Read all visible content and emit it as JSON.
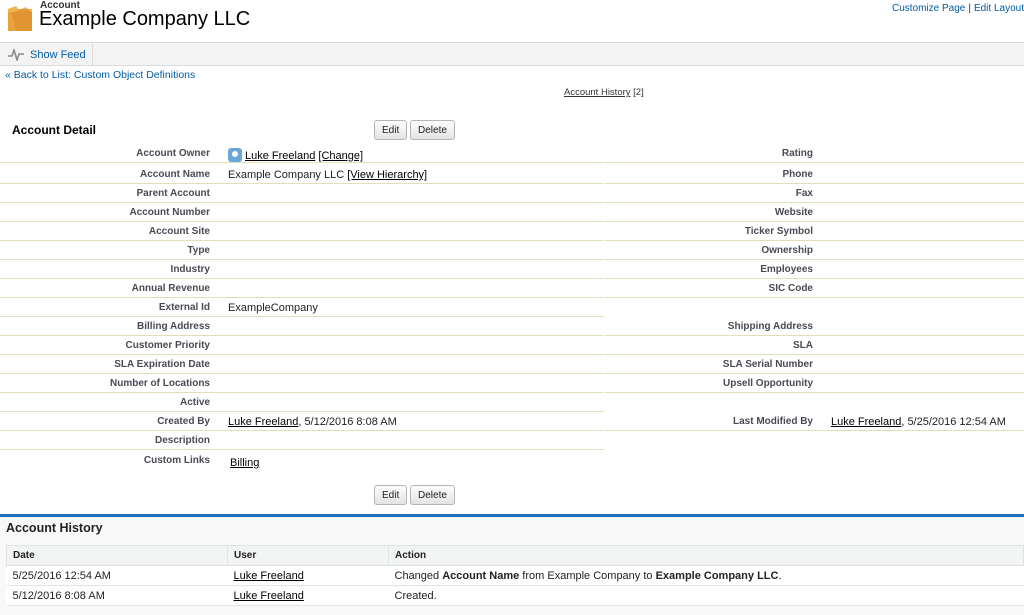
{
  "header": {
    "object_label": "Account",
    "record_title": "Example Company LLC",
    "customize_page": "Customize Page",
    "separator": "|",
    "edit_layout": "Edit Layout"
  },
  "feedbar": {
    "show_feed": "Show Feed"
  },
  "back_link": "« Back to List: Custom Object Definitions",
  "related_link": {
    "label": "Account History",
    "count": "[2]"
  },
  "detail": {
    "title": "Account Detail",
    "edit_label": "Edit",
    "delete_label": "Delete",
    "owner": {
      "label": "Account Owner",
      "name": "Luke Freeland",
      "change": "[Change]"
    },
    "account_name": {
      "label": "Account Name",
      "value": "Example Company LLC",
      "view_hierarchy": "[View Hierarchy]"
    },
    "rating": {
      "label": "Rating",
      "value": ""
    },
    "phone": {
      "label": "Phone",
      "value": ""
    },
    "parent_account": {
      "label": "Parent Account",
      "value": ""
    },
    "fax": {
      "label": "Fax",
      "value": ""
    },
    "account_number": {
      "label": "Account Number",
      "value": ""
    },
    "website": {
      "label": "Website",
      "value": ""
    },
    "account_site": {
      "label": "Account Site",
      "value": ""
    },
    "ticker_symbol": {
      "label": "Ticker Symbol",
      "value": ""
    },
    "type": {
      "label": "Type",
      "value": ""
    },
    "ownership": {
      "label": "Ownership",
      "value": ""
    },
    "industry": {
      "label": "Industry",
      "value": ""
    },
    "employees": {
      "label": "Employees",
      "value": ""
    },
    "annual_revenue": {
      "label": "Annual Revenue",
      "value": ""
    },
    "sic_code": {
      "label": "SIC Code",
      "value": ""
    },
    "external_id": {
      "label": "External Id",
      "value": "ExampleCompany"
    },
    "billing_address": {
      "label": "Billing Address",
      "value": ""
    },
    "shipping_address": {
      "label": "Shipping Address",
      "value": ""
    },
    "customer_priority": {
      "label": "Customer Priority",
      "value": ""
    },
    "sla": {
      "label": "SLA",
      "value": ""
    },
    "sla_expiration": {
      "label": "SLA Expiration Date",
      "value": ""
    },
    "sla_serial": {
      "label": "SLA Serial Number",
      "value": ""
    },
    "num_locations": {
      "label": "Number of Locations",
      "value": ""
    },
    "upsell": {
      "label": "Upsell Opportunity",
      "value": ""
    },
    "active": {
      "label": "Active",
      "value": ""
    },
    "created_by": {
      "label": "Created By",
      "name": "Luke Freeland",
      "date": ", 5/12/2016 8:08 AM"
    },
    "last_modified_by": {
      "label": "Last Modified By",
      "name": "Luke Freeland",
      "date": ", 5/25/2016 12:54 AM"
    },
    "description": {
      "label": "Description",
      "value": ""
    },
    "custom_links": {
      "label": "Custom Links",
      "billing": "Billing"
    }
  },
  "history": {
    "title": "Account History",
    "columns": [
      "Date",
      "User",
      "Action"
    ],
    "rows": [
      {
        "date": "5/25/2016 12:54 AM",
        "user": "Luke Freeland",
        "action_pre": "Changed ",
        "action_field": "Account Name",
        "action_mid": " from Example Company to ",
        "action_new": "Example Company LLC",
        "action_end": "."
      },
      {
        "date": "5/12/2016 8:08 AM",
        "user": "Luke Freeland",
        "action": "Created."
      }
    ]
  },
  "colors": {
    "link_blue": "#015ba7",
    "section_blue": "#236fbd",
    "folder_orange": "#e8a33d",
    "row_divider": "#e3deb8"
  }
}
